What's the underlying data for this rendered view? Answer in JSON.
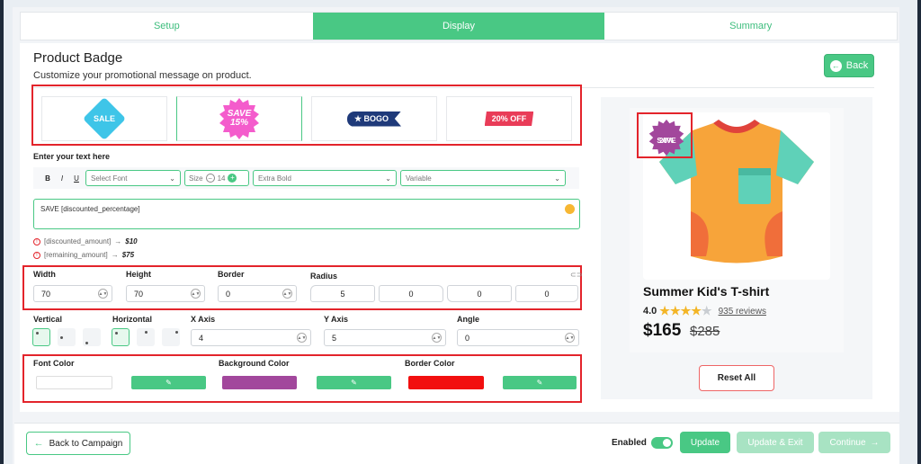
{
  "tabs": [
    {
      "label": "Setup",
      "active": false
    },
    {
      "label": "Display",
      "active": true
    },
    {
      "label": "Summary",
      "active": false
    }
  ],
  "header": {
    "title": "Product Badge",
    "subtitle": "Customize your promotional message on product.",
    "back_label": "Back"
  },
  "badges": {
    "sale": "SALE",
    "save_line1": "SAVE",
    "save_line2": "15%",
    "bogo": "★ BOGO",
    "off": "20% OFF"
  },
  "text_section": {
    "label": "Enter your text here",
    "bold": "B",
    "italic": "I",
    "underline": "U",
    "font_placeholder": "Select Font",
    "size_label": "Size",
    "size_value": "14",
    "weight": "Extra Bold",
    "variant": "Variable",
    "text_value": "SAVE [discounted_percentage]",
    "notes": [
      {
        "token": "[discounted_amount]",
        "arrow": "→",
        "value": "$10"
      },
      {
        "token": "[remaining_amount]",
        "arrow": "→",
        "value": "$75"
      }
    ]
  },
  "dimensions": {
    "width_label": "Width",
    "width": "70",
    "height_label": "Height",
    "height": "70",
    "border_label": "Border",
    "border": "0",
    "radius_label": "Radius",
    "radius": [
      "5",
      "0",
      "0",
      "0"
    ]
  },
  "position": {
    "vertical_label": "Vertical",
    "horizontal_label": "Horizontal",
    "x_label": "X Axis",
    "x": "4",
    "y_label": "Y Axis",
    "y": "5",
    "angle_label": "Angle",
    "angle": "0"
  },
  "colors": {
    "font_label": "Font Color",
    "font": "#ffffff",
    "background_label": "Background Color",
    "background": "#a2479c",
    "border_label": "Border Color",
    "border": "#f20f0f",
    "picker_icon": "✎"
  },
  "preview": {
    "badge_line1": "SAVE",
    "badge_line2": "20%",
    "product_name": "Summer Kid's T-shirt",
    "rating": "4.0",
    "stars_filled": 4,
    "stars_total": 5,
    "reviews": "935 reviews",
    "price": "$165",
    "old_price": "$285",
    "reset_label": "Reset All"
  },
  "footer": {
    "back_campaign": "Back to Campaign",
    "enabled_label": "Enabled",
    "update": "Update",
    "update_exit": "Update & Exit",
    "continue": "Continue"
  }
}
